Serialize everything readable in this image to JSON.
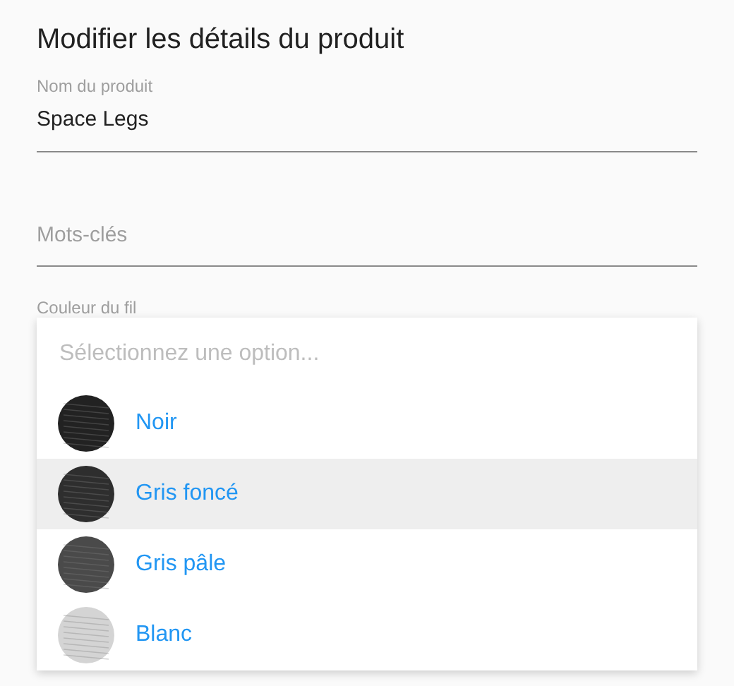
{
  "dialog": {
    "title": "Modifier les détails du produit"
  },
  "fields": [
    {
      "label": "Nom du produit",
      "value": "Space Legs"
    },
    {
      "placeholder": "Mots-clés"
    }
  ],
  "thread_color": {
    "label": "Couleur du fil",
    "dropdown": {
      "placeholder": "Sélectionnez une option...",
      "options": [
        {
          "label": "Noir",
          "color": "#222222",
          "selected": false
        },
        {
          "label": "Gris foncé",
          "color": "#2e2e2e",
          "selected": true
        },
        {
          "label": "Gris pâle",
          "color": "#4a4a4a",
          "selected": false
        },
        {
          "label": "Blanc",
          "color": "#d4d4d4",
          "selected": false
        }
      ]
    }
  }
}
